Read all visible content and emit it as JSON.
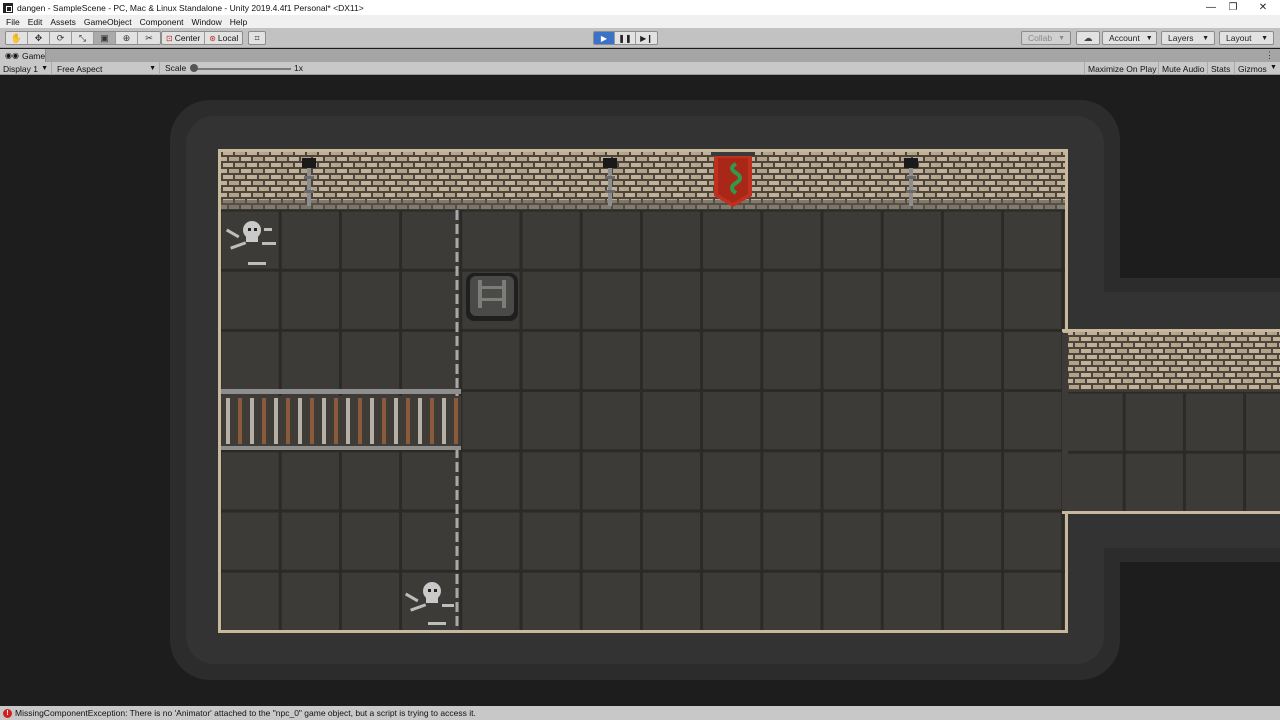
{
  "window": {
    "title": "dangen - SampleScene - PC, Mac & Linux Standalone - Unity 2019.4.4f1 Personal* <DX11>",
    "minimize": "—",
    "restore": "❐",
    "close": "✕"
  },
  "menu": {
    "items": [
      "File",
      "Edit",
      "Assets",
      "GameObject",
      "Component",
      "Window",
      "Help"
    ]
  },
  "toolbar": {
    "tools": [
      {
        "name": "hand-tool",
        "glyph": "✋"
      },
      {
        "name": "move-tool",
        "glyph": "✥"
      },
      {
        "name": "rotate-tool",
        "glyph": "⟳"
      },
      {
        "name": "scale-tool",
        "glyph": "⤡"
      },
      {
        "name": "rect-tool",
        "glyph": "▣"
      },
      {
        "name": "transform-tool",
        "glyph": "⊕"
      },
      {
        "name": "custom-tool",
        "glyph": "✂"
      }
    ],
    "pivot_label": "Center",
    "space_label": "Local",
    "snap_glyph": "⌗",
    "play_glyph": "▶",
    "pause_glyph": "❚❚",
    "step_glyph": "▶❙",
    "collab_label": "Collab",
    "cloud_glyph": "☁",
    "account_label": "Account",
    "layers_label": "Layers",
    "layout_label": "Layout"
  },
  "tab": {
    "label": "Game",
    "menu_glyph": "⋮"
  },
  "game_toolbar": {
    "display": "Display 1",
    "aspect": "Free Aspect",
    "scale_label": "Scale",
    "scale_value": "1x",
    "buttons": [
      "Maximize On Play",
      "Mute Audio",
      "Stats",
      "Gizmos"
    ]
  },
  "status": {
    "message": "MissingComponentException: There is no 'Animator' attached to the \"npc_0\" game object, but a script is trying to access it."
  },
  "colors": {
    "play_active": "#3a72c8",
    "floor": "#3c3b37",
    "wall_brick": "#c2b196",
    "error": "#d02020"
  }
}
